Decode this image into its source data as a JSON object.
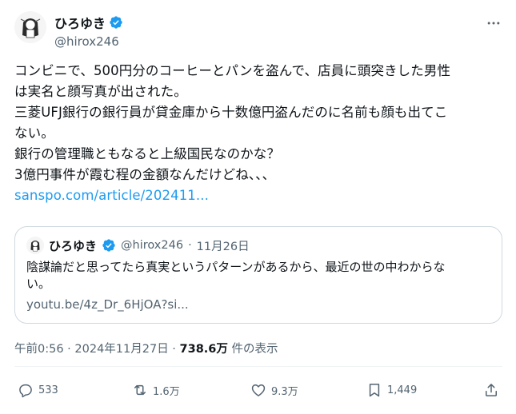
{
  "author": {
    "display_name": "ひろゆき",
    "handle": "@hirox246"
  },
  "tweet": {
    "lines": [
      "コンビニで、500円分のコーヒーとパンを盗んで、店員に頭突きした男性",
      "は実名と顔写真が出された。",
      "三菱UFJ銀行の銀行員が貸金庫から十数億円盗んだのに名前も顔も出てこ",
      "ない。",
      "銀行の管理職ともなると上級国民なのかな？",
      "3億円事件が霞む程の金額なんだけどね、、、"
    ],
    "link": "sanspo.com/article/202411..."
  },
  "quote": {
    "display_name": "ひろゆき",
    "handle": "@hirox246",
    "separator": "·",
    "date": "11月26日",
    "lines": [
      "陰謀論だと思ってたら真実というパターンがあるから、最近の世の中わからな",
      "い。"
    ],
    "link": "youtu.be/4z_Dr_6HjOA?si..."
  },
  "meta": {
    "timestamp": "午前0:56 · 2024年11月27日 · ",
    "views": "738.6万",
    "views_suffix": " 件の表示"
  },
  "actions": {
    "replies": "533",
    "reposts": "1.6万",
    "likes": "9.3万",
    "bookmarks": "1,449"
  },
  "colors": {
    "accent": "#1d9bf0",
    "secondary_text": "#536471",
    "border": "#cfd9de"
  }
}
